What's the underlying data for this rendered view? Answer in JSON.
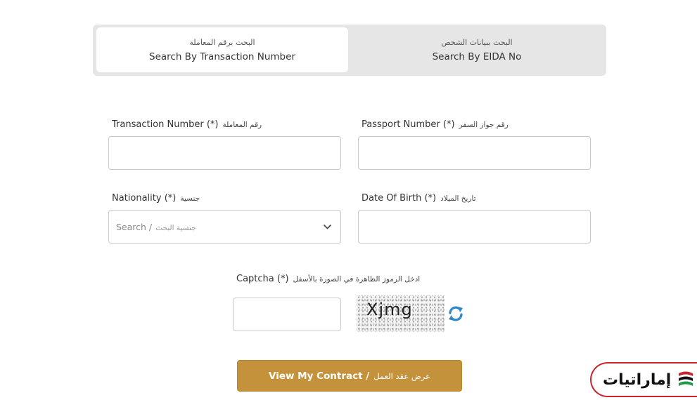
{
  "tabs": {
    "transaction": {
      "ar": "البحث برقم المعاملة",
      "en": "Search By Transaction Number"
    },
    "eida": {
      "ar": "البحث ببيانات الشخص",
      "en": "Search By EIDA No"
    }
  },
  "form": {
    "transaction_number": {
      "en": "Transaction Number (*)",
      "ar": "رقم المعاملة"
    },
    "passport_number": {
      "en": "Passport Number (*)",
      "ar": "رقم جواز السفر"
    },
    "nationality": {
      "en": "Nationality (*)",
      "ar": "جنسية",
      "placeholder_en": "Search /",
      "placeholder_ar": "جنسية البحث"
    },
    "date_of_birth": {
      "en": "Date Of Birth (*)",
      "ar": "تاريخ الميلاد"
    },
    "captcha": {
      "en": "Captcha (*)",
      "ar": "ادخل الرموز الظاهرة في الصورة بالأسفل",
      "code": "Xjmg"
    }
  },
  "submit": {
    "en": "View My Contract /",
    "ar": "عرض عقد العمل"
  },
  "logo": {
    "text": "إماراتيات"
  },
  "colors": {
    "accent": "#c3923a",
    "logo_red": "#c8262d",
    "logo_green": "#1f9a48",
    "refresh_blue": "#2f86c9"
  },
  "icons": {
    "nationality_dropdown": "chevron-down-icon",
    "captcha_refresh": "refresh-icon",
    "logo_mark": "uae-flag-icon"
  }
}
